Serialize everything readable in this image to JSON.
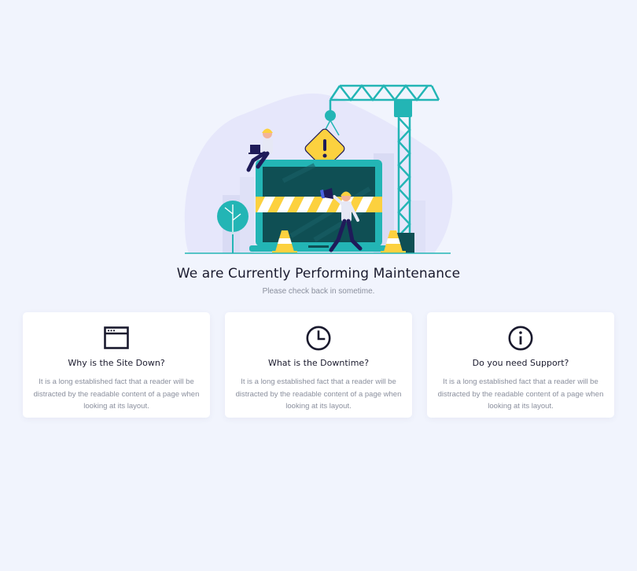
{
  "page": {
    "title": "We are Currently Performing Maintenance",
    "subtitle": "Please check back in sometime."
  },
  "illustration": {
    "name": "under-construction-illustration",
    "colors": {
      "blob": "#e5e6fa",
      "teal": "#23b5b5",
      "dark_teal": "#0f4f54",
      "yellow": "#fcd13f",
      "navy": "#1f1b59"
    }
  },
  "cards": [
    {
      "icon": "browser-window-icon",
      "title": "Why is the Site Down?",
      "text": "It is a long established fact that a reader will be distracted by the readable content of a page when looking at its layout."
    },
    {
      "icon": "clock-icon",
      "title": "What is the Downtime?",
      "text": "It is a long established fact that a reader will be distracted by the readable content of a page when looking at its layout."
    },
    {
      "icon": "info-icon",
      "title": "Do you need Support?",
      "text": "It is a long established fact that a reader will be distracted by the readable content of a page when looking at its layout."
    }
  ],
  "colors": {
    "background": "#f1f4fd",
    "card_background": "#ffffff",
    "heading": "#1b1b2e",
    "muted_text": "#8a8f9d",
    "icon": "#1a1a2e"
  }
}
